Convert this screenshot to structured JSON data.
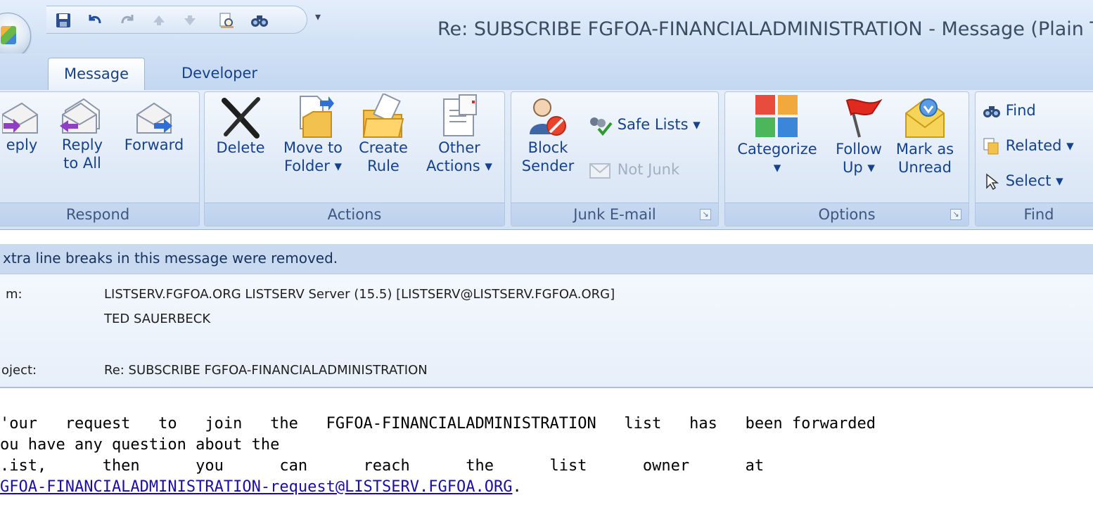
{
  "window": {
    "title": "Re: SUBSCRIBE FGFOA-FINANCIALADMINISTRATION - Message (Plain T"
  },
  "quick_access": [
    "save-icon",
    "undo-icon",
    "redo-icon",
    "up-arrow-icon",
    "down-arrow-icon",
    "print-preview-icon",
    "find-icon"
  ],
  "tabs": [
    {
      "label": "Message"
    },
    {
      "label": "Developer"
    }
  ],
  "ribbon": {
    "respond": {
      "label": "Respond",
      "reply": "eply",
      "reply_all_1": "Reply",
      "reply_all_2": "to All",
      "forward": "Forward"
    },
    "actions": {
      "label": "Actions",
      "delete": "Delete",
      "move_1": "Move to",
      "move_2": "Folder ▾",
      "create_1": "Create",
      "create_2": "Rule",
      "other_1": "Other",
      "other_2": "Actions ▾"
    },
    "junk": {
      "label": "Junk E-mail",
      "block_1": "Block",
      "block_2": "Sender",
      "safe_lists": "Safe Lists ▾",
      "not_junk": "Not Junk"
    },
    "options": {
      "label": "Options",
      "categorize_1": "Categorize",
      "categorize_2": "▾",
      "follow_1": "Follow",
      "follow_2": "Up ▾",
      "mark_1": "Mark as",
      "mark_2": "Unread"
    },
    "find": {
      "label": "Find",
      "find": "Find",
      "related": "Related ▾",
      "select": "Select ▾"
    }
  },
  "infobar": {
    "text": "xtra line breaks in this message were removed."
  },
  "header": {
    "from_label": "m:",
    "from_value": "LISTSERV.FGFOA.ORG LISTSERV Server (15.5) [LISTSERV@LISTSERV.FGFOA.ORG]",
    "to_value": "TED SAUERBECK",
    "subject_label": "oject:",
    "subject_value": "Re: SUBSCRIBE FGFOA-FINANCIALADMINISTRATION"
  },
  "body": {
    "line1": "'our   request   to   join   the   FGFOA-FINANCIALADMINISTRATION   list   has   been forwarded",
    "line2": "ou have any question about the",
    "line3": ".ist,      then      you      can      reach      the      list      owner      at",
    "link": "GFOA-FINANCIALADMINISTRATION-request@LISTSERV.FGFOA.ORG",
    "end": "."
  }
}
